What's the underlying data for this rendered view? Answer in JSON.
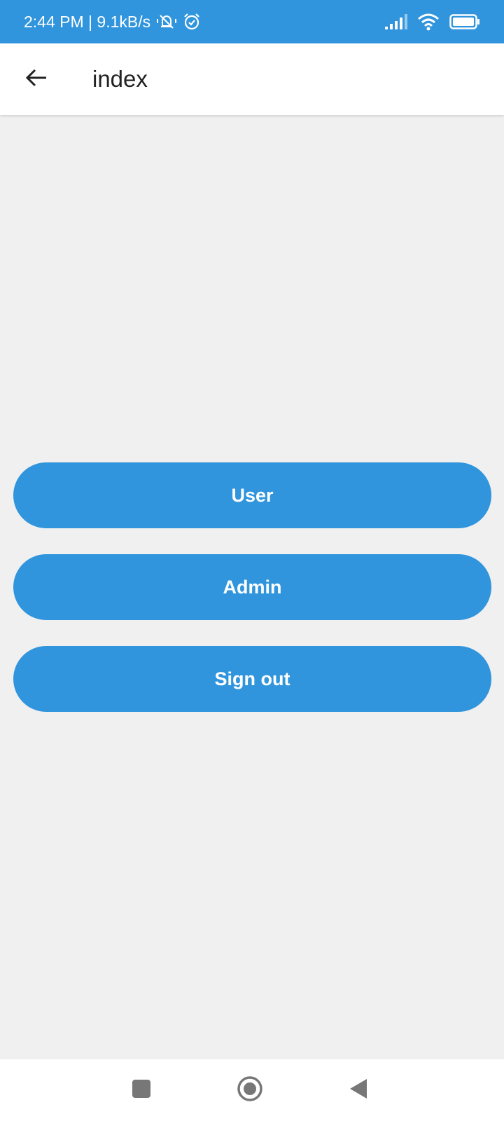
{
  "status_bar": {
    "time_speed": "2:44 PM | 9.1kB/s",
    "icons": [
      "notifications-off-icon",
      "alarm-icon",
      "signal-icon",
      "wifi-icon",
      "battery-icon"
    ]
  },
  "app_bar": {
    "title": "index",
    "back_icon": "arrow-back-icon"
  },
  "buttons": {
    "user": "User",
    "admin": "Admin",
    "sign_out": "Sign out"
  },
  "nav_bar": {
    "icons": [
      "recents-square-icon",
      "home-circle-icon",
      "back-triangle-icon"
    ]
  },
  "colors": {
    "primary": "#3095dc",
    "background": "#f0f0f1",
    "surface": "#ffffff",
    "title_text": "#222222"
  }
}
